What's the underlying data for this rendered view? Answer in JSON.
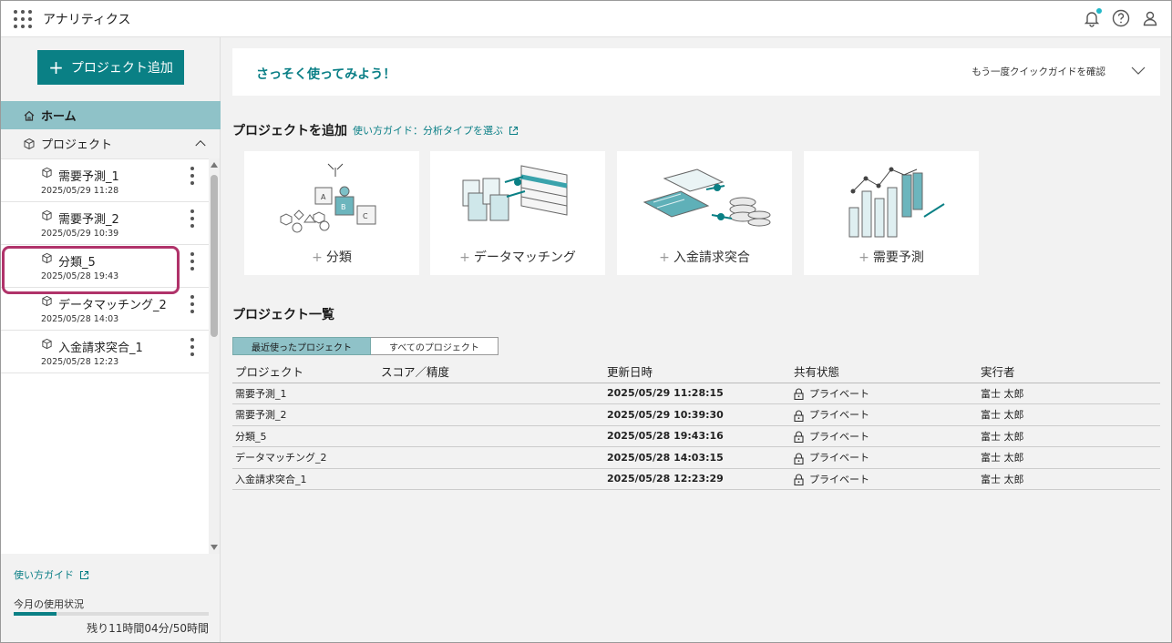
{
  "header": {
    "title": "アナリティクス"
  },
  "sidebar": {
    "add_project_label": "プロジェクト追加",
    "home_label": "ホーム",
    "projects_label": "プロジェクト",
    "items": [
      {
        "name": "需要予測_1",
        "date": "2025/05/29 11:28"
      },
      {
        "name": "需要予測_2",
        "date": "2025/05/29 10:39"
      },
      {
        "name": "分類_5",
        "date": "2025/05/28 19:43"
      },
      {
        "name": "データマッチング_2",
        "date": "2025/05/28 14:03"
      },
      {
        "name": "入金請求突合_1",
        "date": "2025/05/28 12:23"
      }
    ],
    "guide_link": "使い方ガイド",
    "usage_label": "今月の使用状況",
    "usage_remaining": "残り11時間04分/50時間",
    "usage_fraction": 0.22
  },
  "quickstart": {
    "title": "さっそく使ってみよう！",
    "recheck": "もう一度クイックガイドを確認"
  },
  "add_section": {
    "title": "プロジェクトを追加",
    "guide_link": "使い方ガイド：分析タイプを選ぶ",
    "cards": [
      {
        "label": "分類"
      },
      {
        "label": "データマッチング"
      },
      {
        "label": "入金請求突合"
      },
      {
        "label": "需要予測"
      }
    ]
  },
  "list_section": {
    "title": "プロジェクト一覧",
    "tabs": [
      "最近使ったプロジェクト",
      "すべてのプロジェクト"
    ],
    "columns": [
      "プロジェクト",
      "スコア／精度",
      "更新日時",
      "共有状態",
      "実行者"
    ],
    "rows": [
      {
        "project": "需要予測_1",
        "score": "",
        "updated": "2025/05/29 11:28:15",
        "share": "プライベート",
        "owner": "富士 太郎"
      },
      {
        "project": "需要予測_2",
        "score": "",
        "updated": "2025/05/29 10:39:30",
        "share": "プライベート",
        "owner": "富士 太郎"
      },
      {
        "project": "分類_5",
        "score": "",
        "updated": "2025/05/28 19:43:16",
        "share": "プライベート",
        "owner": "富士 太郎"
      },
      {
        "project": "データマッチング_2",
        "score": "",
        "updated": "2025/05/28 14:03:15",
        "share": "プライベート",
        "owner": "富士 太郎"
      },
      {
        "project": "入金請求突合_1",
        "score": "",
        "updated": "2025/05/28 12:23:29",
        "share": "プライベート",
        "owner": "富士 太郎"
      }
    ]
  },
  "colors": {
    "accent": "#0a8085",
    "selected": "#8fc2c8",
    "highlight": "#b0336a"
  }
}
